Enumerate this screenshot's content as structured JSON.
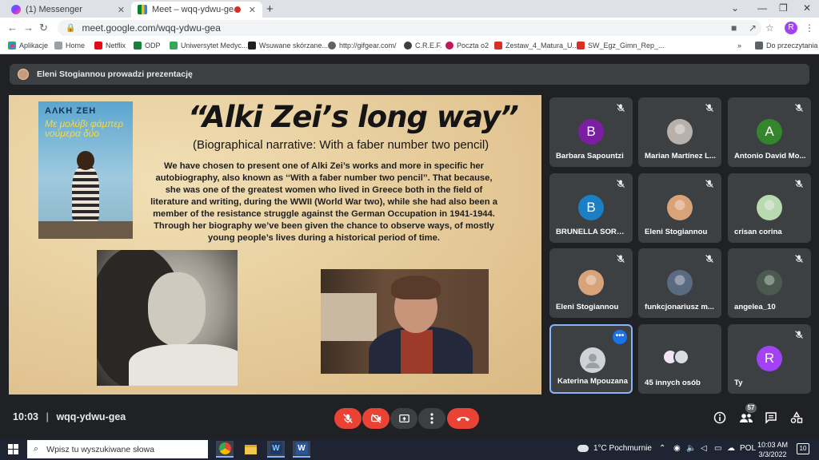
{
  "browser": {
    "tabs": [
      {
        "title": "(1) Messenger",
        "active": false
      },
      {
        "title": "Meet – wqq-ydwu-gea",
        "active": true
      }
    ],
    "url": "meet.google.com/wqq-ydwu-gea",
    "profile_initial": "R",
    "bookmarks": [
      {
        "label": "Aplikacje",
        "icon": "apps-grid-icon"
      },
      {
        "label": "Home",
        "icon": "home-icon"
      },
      {
        "label": "Netflix",
        "icon": "netflix-icon"
      },
      {
        "label": "ODP",
        "icon": "plus-cross-icon"
      },
      {
        "label": "Uniwersytet Medyc...",
        "icon": "bars-icon"
      },
      {
        "label": "Wsuwane skórzane...",
        "icon": "logo-icon"
      },
      {
        "label": "http://gifgear.com/",
        "icon": "gear-icon"
      },
      {
        "label": "C.R.E.F.",
        "icon": "circle-icon"
      },
      {
        "label": "Poczta o2",
        "icon": "mail-icon"
      },
      {
        "label": "Zestaw_4_Matura_U...",
        "icon": "doc-icon"
      },
      {
        "label": "SW_Egz_Gimn_Rep_...",
        "icon": "doc-icon"
      }
    ],
    "reading_list": "Do przeczytania",
    "more_bookmarks": "»"
  },
  "meet": {
    "presenter_banner": "Eleni Stogiannou prowadzi prezentację",
    "meeting_time": "10:03",
    "separator": "|",
    "meeting_code": "wqq-ydwu-gea",
    "people_count": "57"
  },
  "slide": {
    "book_author": "ΑΛΚΗ ΖΕΗ",
    "book_title": "Με μολύβι φάμπερ νούμερα δύο",
    "title": "“Alki Zei’s long way”",
    "subtitle": "(Biographical narrative: With a faber number two pencil)",
    "body": "We have chosen to present one of Alki Zei’s works and more in specific her autobiography, also known as ‘‘With a faber number two pencil’’. That because, she was one of the greatest women who lived in Greece both in the field of literature and writing, during the WWII (World War two), while she had also been a member of the resistance struggle against the German Occupation in 1941-1944. Through her biography we’ve been given the chance to observe ways, of mostly young people’s lives during a historical period of time."
  },
  "participants": [
    {
      "name": "Barbara Sapountzi",
      "avatar": "initial",
      "initial": "B",
      "color": "#7b1fa2",
      "muted": true
    },
    {
      "name": "Marian Martínez L...",
      "avatar": "photo",
      "color": "#b8b0aa",
      "muted": true
    },
    {
      "name": "Antonio David Mo...",
      "avatar": "initial",
      "initial": "A",
      "color": "#33862b",
      "muted": true
    },
    {
      "name": "BRUNELLA SORBE...",
      "avatar": "initial",
      "initial": "B",
      "color": "#1a7fc4",
      "muted": true
    },
    {
      "name": "Eleni Stogiannou",
      "avatar": "photo",
      "color": "#d9a37a",
      "muted": true
    },
    {
      "name": "crisan corina",
      "avatar": "photo",
      "color": "#b9d9b0",
      "muted": true
    },
    {
      "name": "Eleni Stogiannou",
      "avatar": "photo",
      "color": "#d9a37a",
      "muted": true
    },
    {
      "name": "funkcjonariusz m...",
      "avatar": "photo",
      "color": "#5a6a80",
      "muted": true
    },
    {
      "name": "angelea_10",
      "avatar": "photo",
      "color": "#4a5a50",
      "muted": true
    },
    {
      "name": "Katerina Mpouzana",
      "avatar": "default",
      "color": "#cfd2d6",
      "muted": false,
      "speaking": true
    },
    {
      "name": "45 innych osób",
      "avatar": "group",
      "color": "#cfd2d6",
      "muted": false
    },
    {
      "name": "Ty",
      "avatar": "initial",
      "initial": "R",
      "color": "#a142f4",
      "muted": true
    }
  ],
  "taskbar": {
    "search_placeholder": "Wpisz tu wyszukiwane słowa",
    "weather": "1°C  Pochmurnie",
    "language": "POL",
    "time": "10:03 AM",
    "date": "3/3/2022",
    "notifications": "10"
  },
  "colors": {
    "meet_bg": "#202124",
    "tile_bg": "#3c4043",
    "control_red": "#ea4335",
    "accent_blue": "#8ab4f8"
  }
}
